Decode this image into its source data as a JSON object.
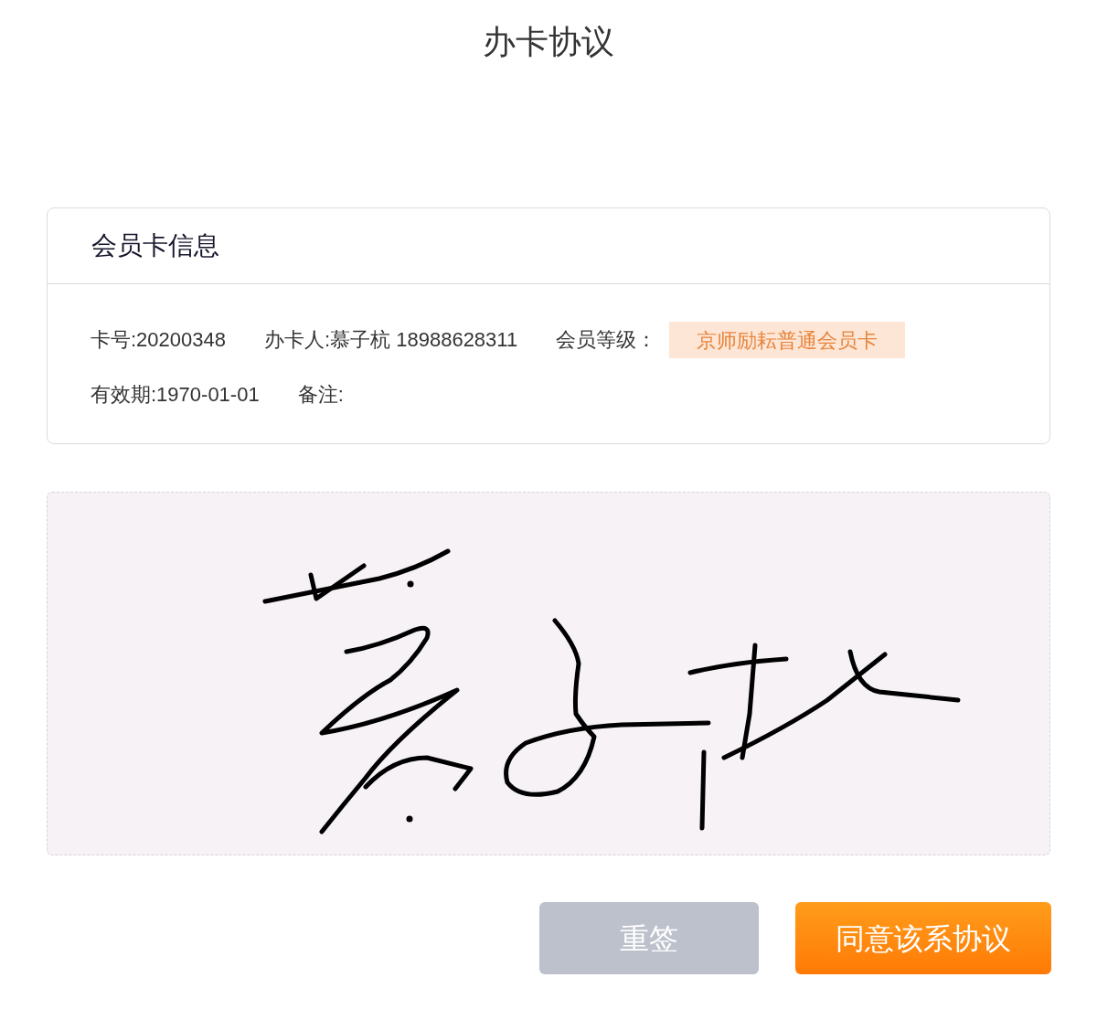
{
  "page": {
    "title": "办卡协议"
  },
  "card": {
    "title": "会员卡信息",
    "rows": [
      [
        {
          "kind": "plain",
          "text": "卡号:20200348"
        },
        {
          "kind": "plain",
          "text": "办卡人:慕子杭 18988628311"
        },
        {
          "kind": "tag",
          "label": "会员等级：",
          "tag": "京师励耘普通会员卡"
        }
      ],
      [
        {
          "kind": "plain",
          "text": "有效期:1970-01-01"
        },
        {
          "kind": "plain",
          "text": "备注:"
        }
      ]
    ]
  },
  "signature_pad": {
    "signed": true
  },
  "buttons": [
    {
      "kind": "secondary",
      "label": "重签"
    },
    {
      "kind": "primary",
      "label": "同意该系协议"
    }
  ]
}
